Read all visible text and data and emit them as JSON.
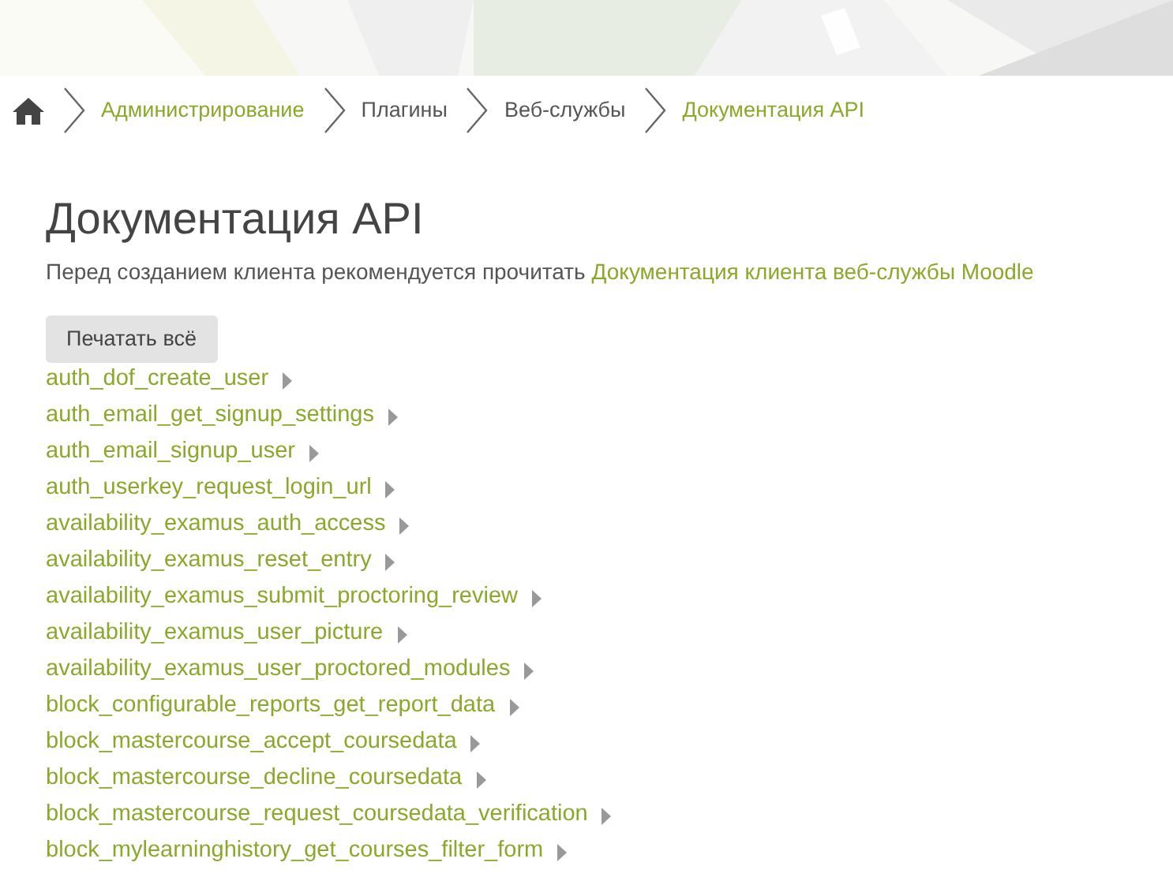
{
  "breadcrumb": [
    {
      "label": "Администрирование",
      "link": true
    },
    {
      "label": "Плагины",
      "link": false
    },
    {
      "label": "Веб-службы",
      "link": false
    },
    {
      "label": "Документация API",
      "link": true
    }
  ],
  "title": "Документация API",
  "intro": {
    "text": "Перед созданием клиента рекомендуется прочитать",
    "link": "Документация клиента веб-службы Moodle"
  },
  "print_button": "Печатать всё",
  "functions": [
    {
      "name": "auth_dof_create_user",
      "expanded": false
    },
    {
      "name": "auth_email_get_signup_settings",
      "expanded": false
    },
    {
      "name": "auth_email_signup_user",
      "expanded": false
    },
    {
      "name": "auth_userkey_request_login_url",
      "expanded": false
    },
    {
      "name": "availability_examus_auth_access",
      "expanded": false
    },
    {
      "name": "availability_examus_reset_entry",
      "expanded": false
    },
    {
      "name": "availability_examus_submit_proctoring_review",
      "expanded": false
    },
    {
      "name": "availability_examus_user_picture",
      "expanded": false
    },
    {
      "name": "availability_examus_user_proctored_modules",
      "expanded": false
    },
    {
      "name": "block_configurable_reports_get_report_data",
      "expanded": false
    },
    {
      "name": "block_mastercourse_accept_coursedata",
      "expanded": false
    },
    {
      "name": "block_mastercourse_decline_coursedata",
      "expanded": false
    },
    {
      "name": "block_mastercourse_request_coursedata_verification",
      "expanded": false
    },
    {
      "name": "block_mylearninghistory_get_courses_filter_form",
      "expanded": false
    }
  ]
}
